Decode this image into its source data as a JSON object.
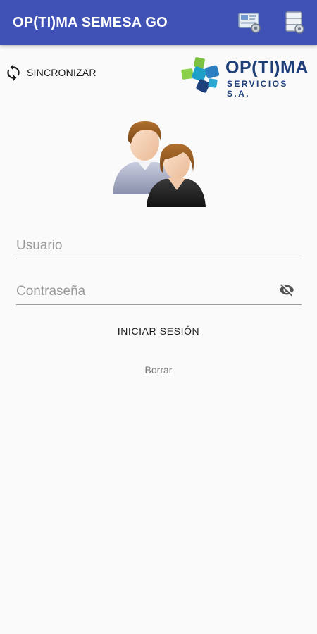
{
  "app_bar": {
    "title": "OP(TI)MA SEMESA GO",
    "background": "#3f51b5",
    "actions": [
      {
        "icon": "server-settings-icon"
      },
      {
        "icon": "database-settings-icon"
      }
    ]
  },
  "sync": {
    "icon": "sync-icon",
    "label": "SINCRONIZAR"
  },
  "logo": {
    "wordmark": "OP(TI)MA",
    "subtitle": "SERVICIOS S.A."
  },
  "avatar": {
    "icon": "users-avatar-icon"
  },
  "form": {
    "username_placeholder": "Usuario",
    "username_value": "",
    "password_placeholder": "Contraseña",
    "password_value": "",
    "password_toggle_icon": "eye-off-icon"
  },
  "buttons": {
    "login_label": "INICIAR SESIÓN",
    "clear_label": "Borrar"
  }
}
